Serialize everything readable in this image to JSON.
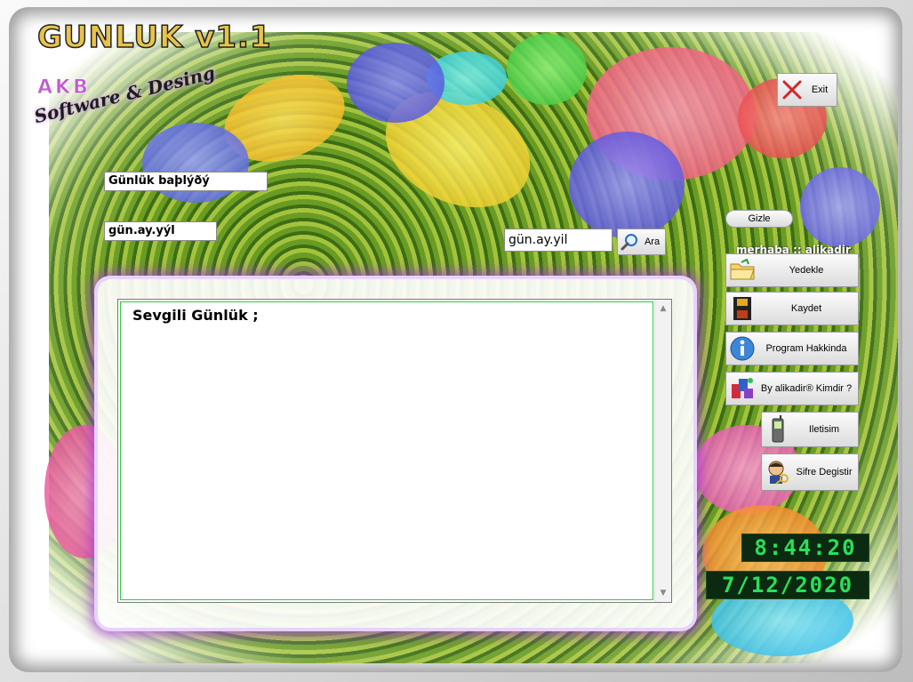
{
  "app": {
    "title": "GUNLUK v1.1",
    "brand_akb": "AKB",
    "brand_tagline": "Software & Desing"
  },
  "header": {
    "exit_label": "Exit"
  },
  "fields": {
    "title_value": "Günlük baþlýðý",
    "date_value": "gün.ay.yýl",
    "search_date_value": "gün.ay.yil"
  },
  "search": {
    "button_label": "Ara"
  },
  "editor": {
    "content": "Sevgili Günlük ;"
  },
  "sidebar": {
    "hide_label": "Gizle",
    "greeting": "merhaba :: alikadir",
    "buttons": [
      {
        "label": "Yedekle",
        "icon": "folder-open-icon"
      },
      {
        "label": "Kaydet",
        "icon": "floppy-disk-icon"
      },
      {
        "label": "Program Hakkinda",
        "icon": "info-icon"
      },
      {
        "label": "By alikadir® Kimdir ?",
        "icon": "blocks-icon"
      },
      {
        "label": "Iletisim",
        "icon": "cellphone-icon"
      },
      {
        "label": "Sifre Degistir",
        "icon": "user-key-icon"
      }
    ]
  },
  "clock": {
    "time": "8:44:20",
    "date": "7/12/2020"
  },
  "colors": {
    "digital_fg": "#28e05a",
    "digital_bg": "#0c2a12",
    "panel_glow": "#aa3cdc",
    "editor_border": "#2ecc40"
  }
}
